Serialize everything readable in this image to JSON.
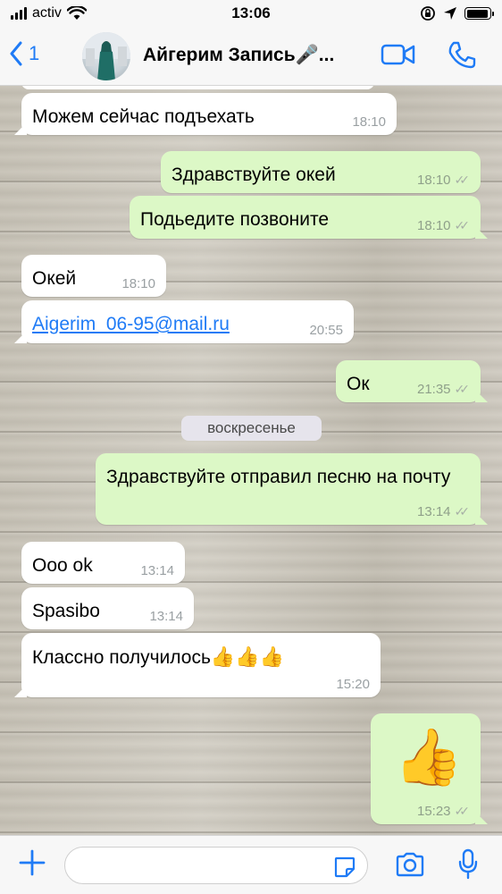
{
  "status_bar": {
    "carrier": "activ",
    "time": "13:06",
    "battery_level": 0.92
  },
  "header": {
    "back_label": "1",
    "contact_name": "Айгерим Запись",
    "title_suffix": "...",
    "title_emoji": "🎤"
  },
  "date_divider": "воскресенье",
  "messages": [
    {
      "direction": "in",
      "text": "Можем сейчас подъехать",
      "time": "18:10"
    },
    {
      "direction": "out",
      "text": "Здравствуйте окей",
      "time": "18:10",
      "ticks": "✓✓"
    },
    {
      "direction": "out",
      "text": "Подьедите позвоните",
      "time": "18:10",
      "ticks": "✓✓"
    },
    {
      "direction": "in",
      "text": "Окей",
      "time": "18:10"
    },
    {
      "direction": "in",
      "text": "Aigerim_06-95@mail.ru",
      "time": "20:55"
    },
    {
      "direction": "out",
      "text": "Ок",
      "time": "21:35",
      "ticks": "✓✓"
    },
    {
      "direction": "out",
      "text": "Здравствуйте отправил песню на почту",
      "time": "13:14",
      "ticks": "✓✓"
    },
    {
      "direction": "in",
      "text": "Ооо ok",
      "time": "13:14"
    },
    {
      "direction": "in",
      "text": "Spasibo",
      "time": "13:14"
    },
    {
      "direction": "in",
      "text": "Классно получилось",
      "time": "15:20",
      "emoji": "👍👍👍"
    },
    {
      "direction": "out",
      "text": "👍",
      "time": "15:23",
      "ticks": "✓✓"
    }
  ],
  "colors": {
    "accent": "#1f7bf6",
    "incoming_bubble": "#ffffff",
    "outgoing_bubble": "#dcf8c6"
  }
}
